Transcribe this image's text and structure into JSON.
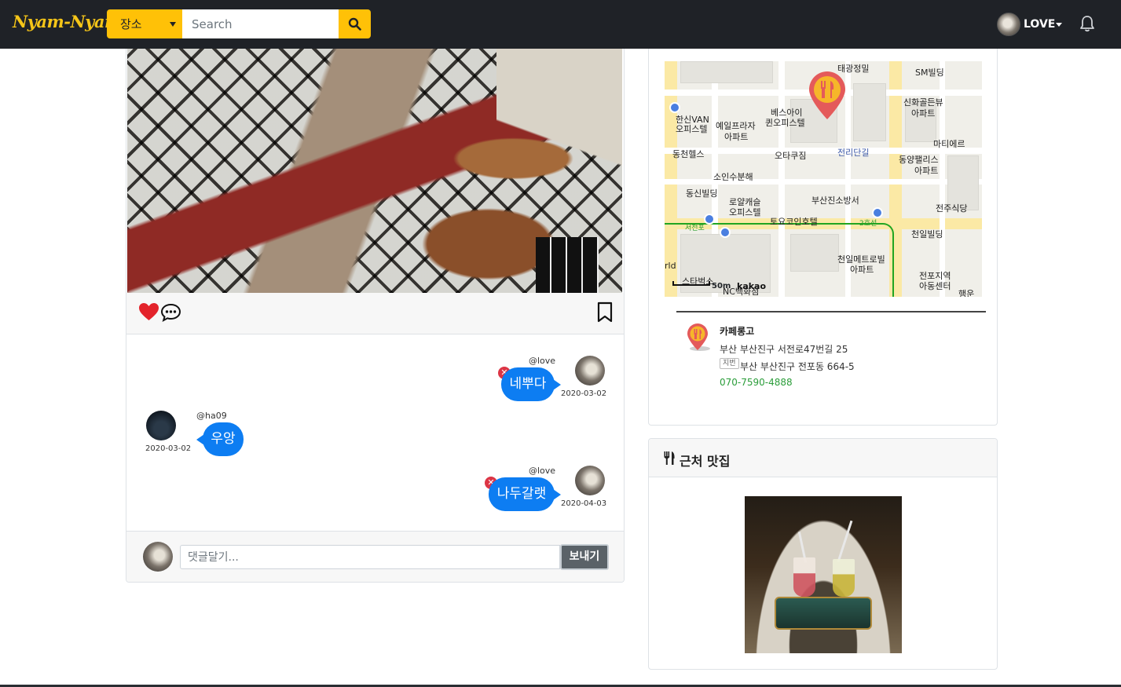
{
  "navbar": {
    "brand": "Nyam-Nyam",
    "category_selected": "장소",
    "search_placeholder": "Search",
    "user_name": "LOVE"
  },
  "post": {
    "liked": true,
    "comments": [
      {
        "handle": "@love",
        "text": "네뿌다",
        "date": "2020-03-02",
        "side": "right",
        "deletable": true
      },
      {
        "handle": "@ha09",
        "text": "우앙",
        "date": "2020-03-02",
        "side": "left",
        "deletable": false
      },
      {
        "handle": "@love",
        "text": "나두갈랫",
        "date": "2020-04-03",
        "side": "right",
        "deletable": true
      }
    ],
    "comment_form": {
      "placeholder": "댓글달기...",
      "send_label": "보내기"
    }
  },
  "map": {
    "labels": [
      "태광정밀",
      "SM빌딩",
      "신화골든뷰",
      "아파트",
      "한신VAN",
      "오피스텔",
      "예일프라자",
      "아파트",
      "베스아이",
      "퀸오피스텔",
      "동천헬스",
      "오타쿠짐",
      "전리단길",
      "마티에르",
      "동양팰리스",
      "아파트",
      "소인수분해",
      "동신빌딩",
      "로얄캐슬",
      "오피스텔",
      "부산진소방서",
      "전주식당",
      "토요코인호텔",
      "서전포",
      "천일빌딩",
      "천일메트로빌",
      "아파트",
      "전포지역",
      "아동센터",
      "스타벅스",
      "NC백화점",
      "rld",
      "행운"
    ],
    "station": "2호선",
    "scale": "50m",
    "logo": "kakao"
  },
  "place": {
    "name": "카페롱고",
    "road_address": "부산 부산진구 서전로47번길 25",
    "jibun_badge": "지번",
    "jibun_address": "부산 부산진구 전포동 664-5",
    "phone": "070-7590-4888"
  },
  "nearby": {
    "title": "근처 맛집"
  },
  "colors": {
    "accent": "#ffc107",
    "navbar": "#1f2227",
    "bubble": "#0d7df2",
    "delete": "#dc3545",
    "phone": "#2b9d3a"
  }
}
